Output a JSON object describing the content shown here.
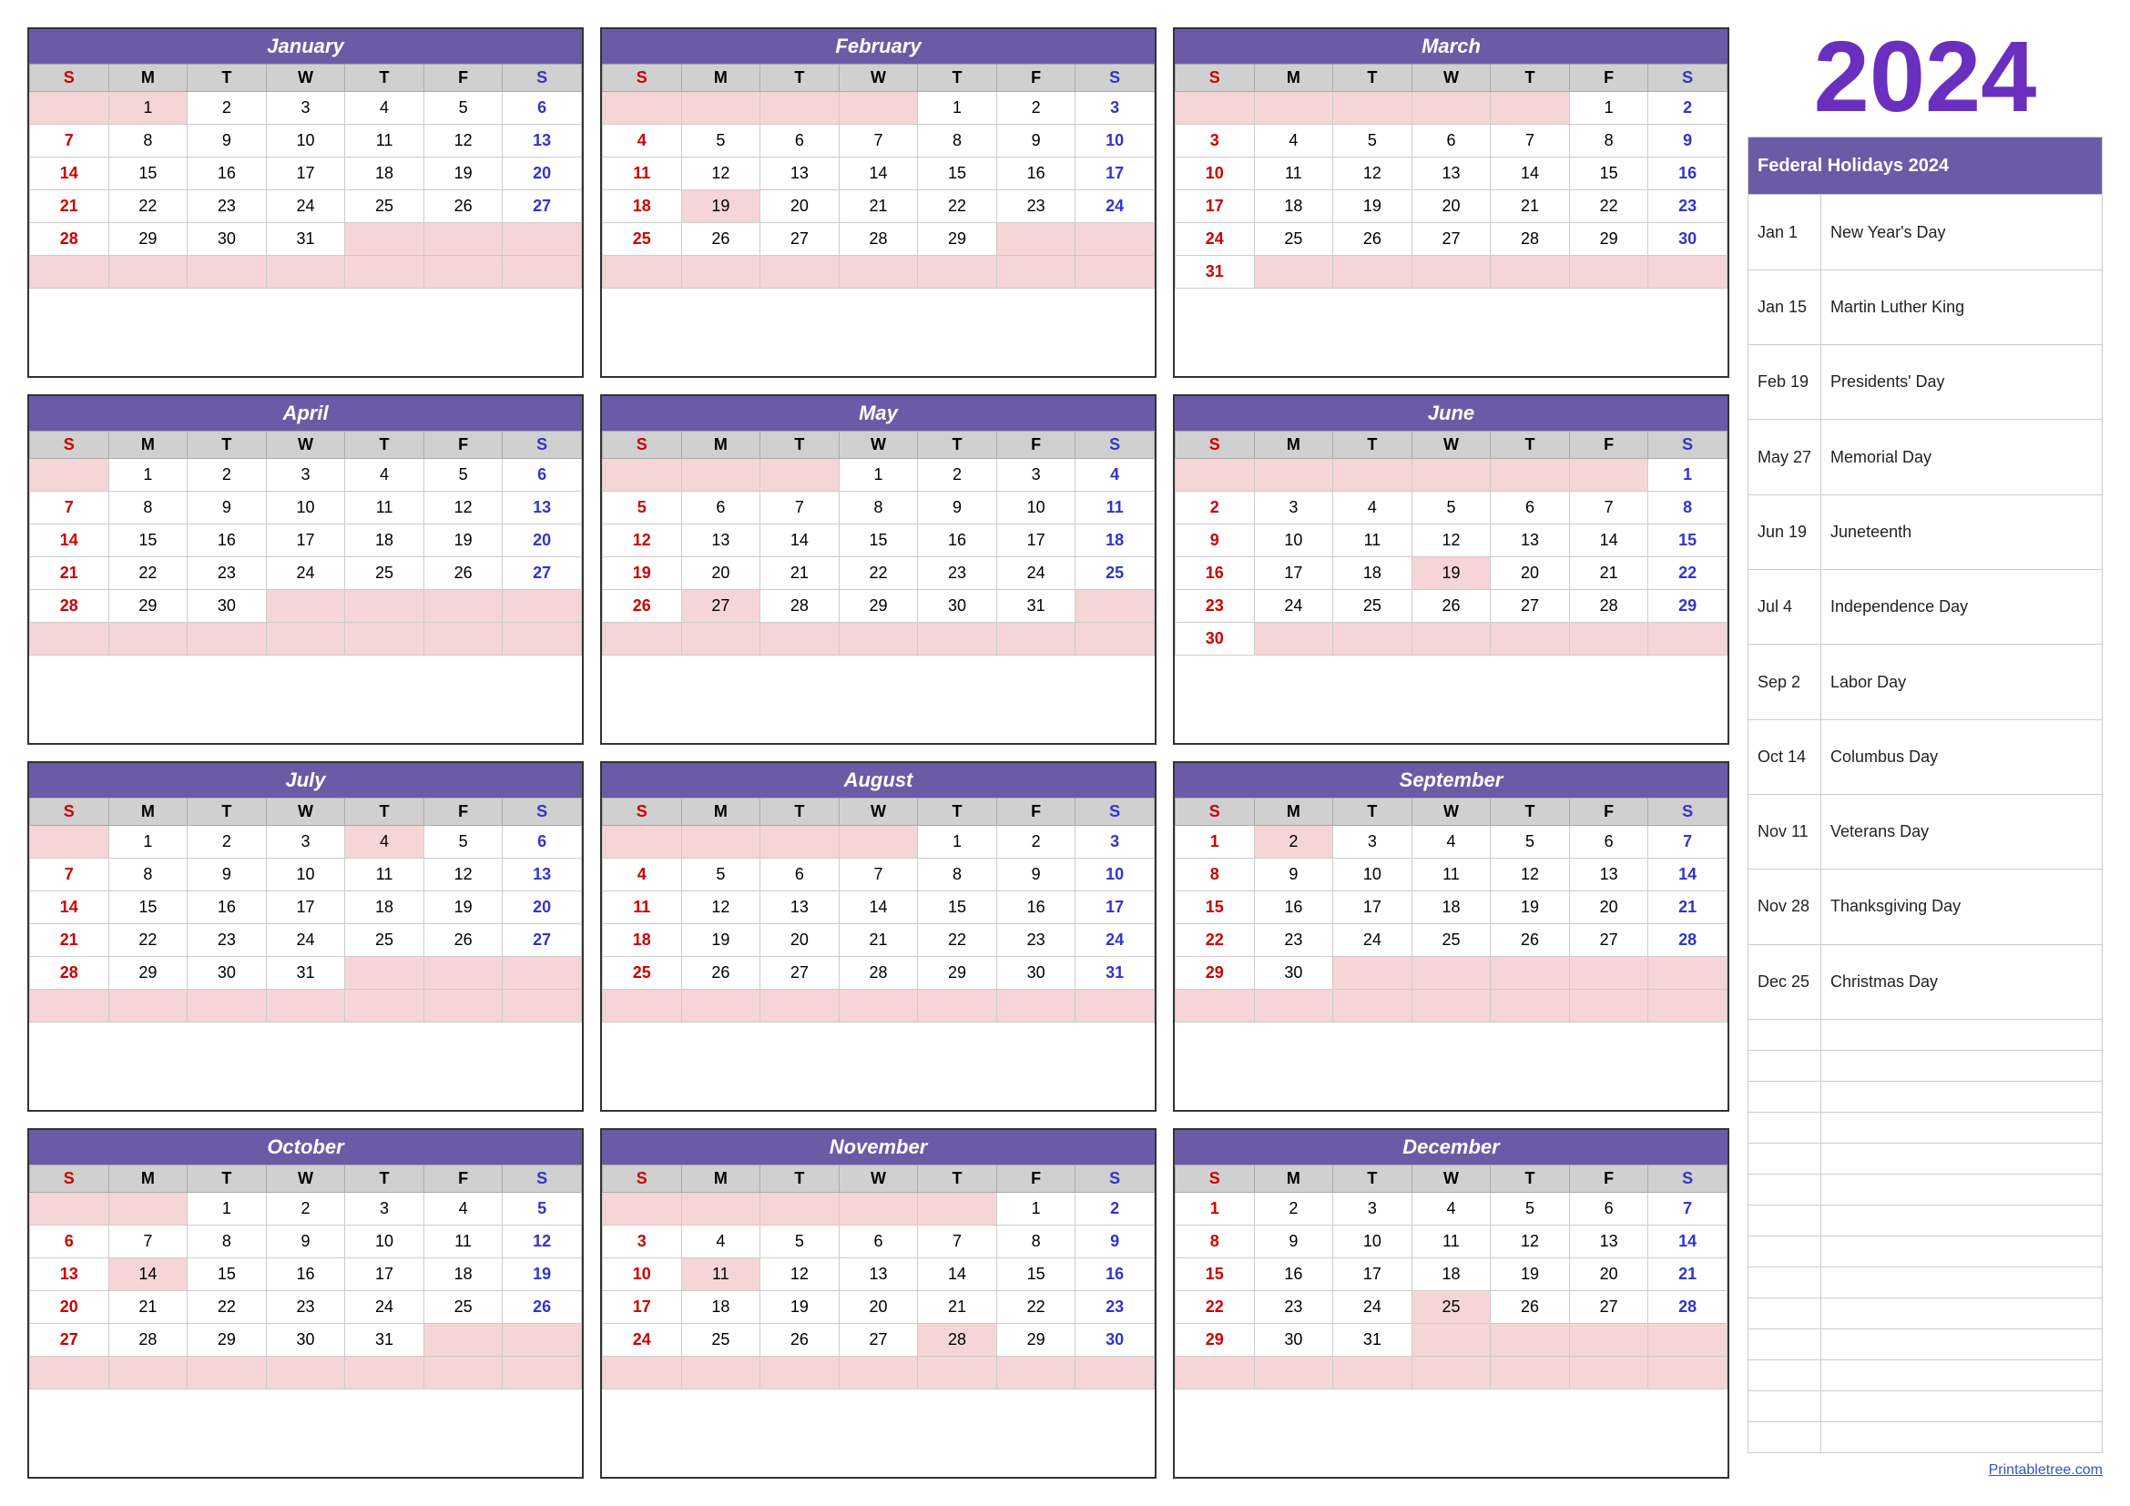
{
  "year": "2024",
  "months": [
    {
      "name": "January",
      "days": [
        [
          "",
          1,
          2,
          3,
          4,
          5,
          6
        ],
        [
          7,
          8,
          9,
          10,
          11,
          12,
          13
        ],
        [
          14,
          15,
          16,
          17,
          18,
          19,
          20
        ],
        [
          21,
          22,
          23,
          24,
          25,
          26,
          27
        ],
        [
          28,
          29,
          30,
          31,
          "",
          "",
          ""
        ]
      ],
      "holidays": [
        1
      ]
    },
    {
      "name": "February",
      "days": [
        [
          "",
          "",
          "",
          "",
          1,
          2,
          3
        ],
        [
          4,
          5,
          6,
          7,
          8,
          9,
          10
        ],
        [
          11,
          12,
          13,
          14,
          15,
          16,
          17
        ],
        [
          18,
          19,
          20,
          21,
          22,
          23,
          24
        ],
        [
          25,
          26,
          27,
          28,
          29,
          "",
          ""
        ]
      ],
      "holidays": [
        19
      ]
    },
    {
      "name": "March",
      "days": [
        [
          "",
          "",
          "",
          "",
          "",
          1,
          2
        ],
        [
          3,
          4,
          5,
          6,
          7,
          8,
          9
        ],
        [
          10,
          11,
          12,
          13,
          14,
          15,
          16
        ],
        [
          17,
          18,
          19,
          20,
          21,
          22,
          23
        ],
        [
          24,
          25,
          26,
          27,
          28,
          29,
          30
        ],
        [
          31,
          "",
          "",
          "",
          "",
          "",
          ""
        ]
      ],
      "holidays": []
    },
    {
      "name": "April",
      "days": [
        [
          "",
          1,
          2,
          3,
          4,
          5,
          6
        ],
        [
          7,
          8,
          9,
          10,
          11,
          12,
          13
        ],
        [
          14,
          15,
          16,
          17,
          18,
          19,
          20
        ],
        [
          21,
          22,
          23,
          24,
          25,
          26,
          27
        ],
        [
          28,
          29,
          30,
          "",
          "",
          "",
          ""
        ]
      ],
      "holidays": []
    },
    {
      "name": "May",
      "days": [
        [
          "",
          "",
          "",
          1,
          2,
          3,
          4
        ],
        [
          5,
          6,
          7,
          8,
          9,
          10,
          11
        ],
        [
          12,
          13,
          14,
          15,
          16,
          17,
          18
        ],
        [
          19,
          20,
          21,
          22,
          23,
          24,
          25
        ],
        [
          26,
          27,
          28,
          29,
          30,
          31,
          ""
        ]
      ],
      "holidays": [
        27
      ]
    },
    {
      "name": "June",
      "days": [
        [
          "",
          "",
          "",
          "",
          "",
          "",
          1
        ],
        [
          2,
          3,
          4,
          5,
          6,
          7,
          8
        ],
        [
          9,
          10,
          11,
          12,
          13,
          14,
          15
        ],
        [
          16,
          17,
          18,
          19,
          20,
          21,
          22
        ],
        [
          23,
          24,
          25,
          26,
          27,
          28,
          29
        ],
        [
          30,
          "",
          "",
          "",
          "",
          "",
          ""
        ]
      ],
      "holidays": [
        19
      ]
    },
    {
      "name": "July",
      "days": [
        [
          "",
          1,
          2,
          3,
          4,
          5,
          6
        ],
        [
          7,
          8,
          9,
          10,
          11,
          12,
          13
        ],
        [
          14,
          15,
          16,
          17,
          18,
          19,
          20
        ],
        [
          21,
          22,
          23,
          24,
          25,
          26,
          27
        ],
        [
          28,
          29,
          30,
          31,
          "",
          "",
          ""
        ]
      ],
      "holidays": [
        4
      ]
    },
    {
      "name": "August",
      "days": [
        [
          "",
          "",
          "",
          "",
          1,
          2,
          3
        ],
        [
          4,
          5,
          6,
          7,
          8,
          9,
          10
        ],
        [
          11,
          12,
          13,
          14,
          15,
          16,
          17
        ],
        [
          18,
          19,
          20,
          21,
          22,
          23,
          24
        ],
        [
          25,
          26,
          27,
          28,
          29,
          30,
          31
        ]
      ],
      "holidays": []
    },
    {
      "name": "September",
      "days": [
        [
          1,
          2,
          3,
          4,
          5,
          6,
          7
        ],
        [
          8,
          9,
          10,
          11,
          12,
          13,
          14
        ],
        [
          15,
          16,
          17,
          18,
          19,
          20,
          21
        ],
        [
          22,
          23,
          24,
          25,
          26,
          27,
          28
        ],
        [
          29,
          30,
          "",
          "",
          "",
          "",
          ""
        ]
      ],
      "holidays": [
        2
      ]
    },
    {
      "name": "October",
      "days": [
        [
          "",
          "",
          1,
          2,
          3,
          4,
          5
        ],
        [
          6,
          7,
          8,
          9,
          10,
          11,
          12
        ],
        [
          13,
          14,
          15,
          16,
          17,
          18,
          19
        ],
        [
          20,
          21,
          22,
          23,
          24,
          25,
          26
        ],
        [
          27,
          28,
          29,
          30,
          31,
          "",
          ""
        ]
      ],
      "holidays": [
        14
      ]
    },
    {
      "name": "November",
      "days": [
        [
          "",
          "",
          "",
          "",
          "",
          1,
          2
        ],
        [
          3,
          4,
          5,
          6,
          7,
          8,
          9
        ],
        [
          10,
          11,
          12,
          13,
          14,
          15,
          16
        ],
        [
          17,
          18,
          19,
          20,
          21,
          22,
          23
        ],
        [
          24,
          25,
          26,
          27,
          28,
          29,
          30
        ]
      ],
      "holidays": [
        11,
        28
      ]
    },
    {
      "name": "December",
      "days": [
        [
          1,
          2,
          3,
          4,
          5,
          6,
          7
        ],
        [
          8,
          9,
          10,
          11,
          12,
          13,
          14
        ],
        [
          15,
          16,
          17,
          18,
          19,
          20,
          21
        ],
        [
          22,
          23,
          24,
          25,
          26,
          27,
          28
        ],
        [
          29,
          30,
          31,
          "",
          "",
          "",
          ""
        ]
      ],
      "holidays": [
        25
      ]
    }
  ],
  "day_headers": [
    "S",
    "M",
    "T",
    "W",
    "T",
    "F",
    "S"
  ],
  "federal_holidays_header": "Federal Holidays 2024",
  "federal_holidays": [
    {
      "date": "Jan 1",
      "name": "New Year's Day"
    },
    {
      "date": "Jan 15",
      "name": "Martin Luther King"
    },
    {
      "date": "Feb 19",
      "name": "Presidents' Day"
    },
    {
      "date": "May 27",
      "name": "Memorial Day"
    },
    {
      "date": "Jun 19",
      "name": "Juneteenth"
    },
    {
      "date": "Jul 4",
      "name": "Independence Day"
    },
    {
      "date": "Sep 2",
      "name": "Labor Day"
    },
    {
      "date": "Oct 14",
      "name": "Columbus Day"
    },
    {
      "date": "Nov 11",
      "name": "Veterans Day"
    },
    {
      "date": "Nov 28",
      "name": "Thanksgiving Day"
    },
    {
      "date": "Dec 25",
      "name": "Christmas Day"
    }
  ],
  "footer_link": "Printabletree.com"
}
